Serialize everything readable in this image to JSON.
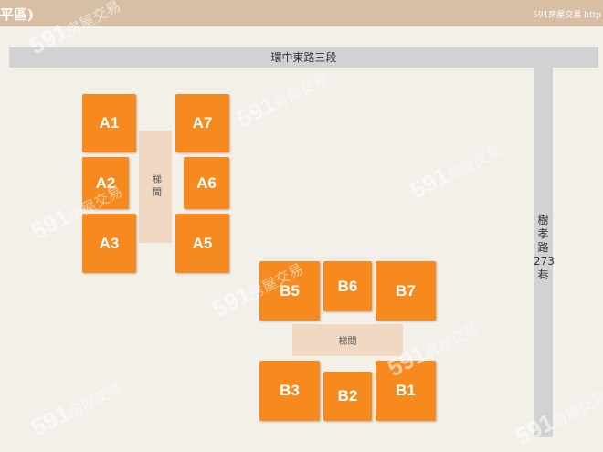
{
  "header": {
    "title": "平區)",
    "brand": "591房屋交易 http"
  },
  "roads": {
    "horizontal": "環中東路三段",
    "vertical": "樹\n孝\n路\n273\n巷"
  },
  "stairs": {
    "a": "梯間",
    "b": "梯間"
  },
  "units": {
    "a1": "A1",
    "a2": "A2",
    "a3": "A3",
    "a5": "A5",
    "a6": "A6",
    "a7": "A7",
    "b1": "B1",
    "b2": "B2",
    "b3": "B3",
    "b5": "B5",
    "b6": "B6",
    "b7": "B7"
  },
  "watermark": {
    "num": "591",
    "text": "房屋交易"
  },
  "colors": {
    "unit": "#f68a1e",
    "stair": "#f0d8c2",
    "road": "#d2d2d2",
    "header": "#d7bfa6"
  }
}
